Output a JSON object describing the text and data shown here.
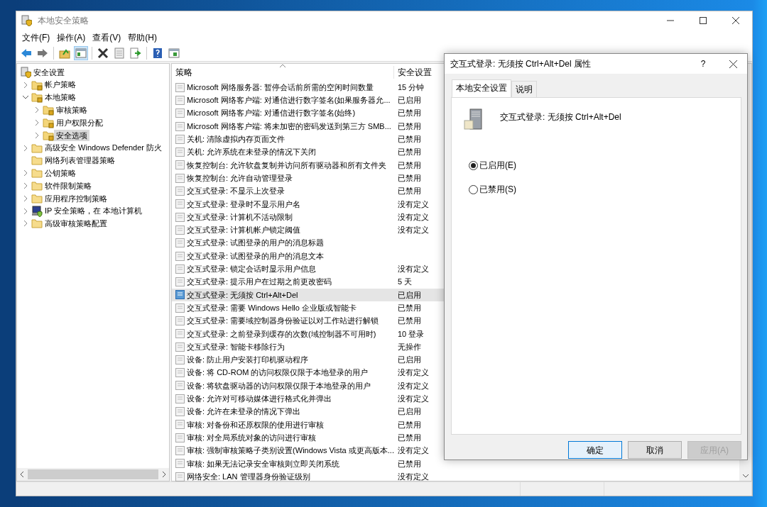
{
  "window": {
    "title": "本地安全策略"
  },
  "menu": [
    "文件(F)",
    "操作(A)",
    "查看(V)",
    "帮助(H)"
  ],
  "toolbar": [
    {
      "kind": "back"
    },
    {
      "kind": "forward"
    },
    {
      "kind": "sep"
    },
    {
      "kind": "up"
    },
    {
      "kind": "tree",
      "selected": true
    },
    {
      "kind": "sep"
    },
    {
      "kind": "delete"
    },
    {
      "kind": "properties"
    },
    {
      "kind": "export"
    },
    {
      "kind": "sep"
    },
    {
      "kind": "help"
    },
    {
      "kind": "view"
    }
  ],
  "tree": [
    {
      "label": "安全设置",
      "kind": "root",
      "selected": false,
      "children": [
        {
          "label": "帐户策略",
          "kind": "secure-folder",
          "expanded": false,
          "selected": false
        },
        {
          "label": "本地策略",
          "kind": "secure-folder",
          "expanded": true,
          "selected": false,
          "children": [
            {
              "label": "审核策略",
              "kind": "secure-folder",
              "expanded": false,
              "selected": false
            },
            {
              "label": "用户权限分配",
              "kind": "secure-folder",
              "expanded": false,
              "selected": false
            },
            {
              "label": "安全选项",
              "kind": "secure-folder",
              "expanded": false,
              "selected": true
            }
          ]
        },
        {
          "label": "高级安全 Windows Defender 防火",
          "kind": "folder",
          "expanded": false,
          "selected": false
        },
        {
          "label": "网络列表管理器策略",
          "kind": "folder",
          "selected": false
        },
        {
          "label": "公钥策略",
          "kind": "folder",
          "expanded": false,
          "selected": false
        },
        {
          "label": "软件限制策略",
          "kind": "folder",
          "expanded": false,
          "selected": false
        },
        {
          "label": "应用程序控制策略",
          "kind": "folder",
          "expanded": false,
          "selected": false
        },
        {
          "label": "IP 安全策略，在 本地计算机",
          "kind": "ip-security",
          "expanded": false,
          "selected": false
        },
        {
          "label": "高级审核策略配置",
          "kind": "folder",
          "expanded": false,
          "selected": false
        }
      ]
    }
  ],
  "table": {
    "columns": [
      "策略",
      "安全设置"
    ],
    "rows": [
      {
        "policy": "Microsoft 网络服务器: 暂停会话前所需的空闲时间数量",
        "setting": "15 分钟",
        "selected": false
      },
      {
        "policy": "Microsoft 网络客户端: 对通信进行数字签名(如果服务器允...",
        "setting": "已启用",
        "selected": false
      },
      {
        "policy": "Microsoft 网络客户端: 对通信进行数字签名(始终)",
        "setting": "已禁用",
        "selected": false
      },
      {
        "policy": "Microsoft 网络客户端: 将未加密的密码发送到第三方 SMB...",
        "setting": "已禁用",
        "selected": false
      },
      {
        "policy": "关机: 清除虚拟内存页面文件",
        "setting": "已禁用",
        "selected": false
      },
      {
        "policy": "关机: 允许系统在未登录的情况下关闭",
        "setting": "已禁用",
        "selected": false
      },
      {
        "policy": "恢复控制台: 允许软盘复制并访问所有驱动器和所有文件夹",
        "setting": "已禁用",
        "selected": false
      },
      {
        "policy": "恢复控制台: 允许自动管理登录",
        "setting": "已禁用",
        "selected": false
      },
      {
        "policy": "交互式登录: 不显示上次登录",
        "setting": "已禁用",
        "selected": false
      },
      {
        "policy": "交互式登录: 登录时不显示用户名",
        "setting": "没有定义",
        "selected": false
      },
      {
        "policy": "交互式登录: 计算机不活动限制",
        "setting": "没有定义",
        "selected": false
      },
      {
        "policy": "交互式登录: 计算机帐户锁定阈值",
        "setting": "没有定义",
        "selected": false
      },
      {
        "policy": "交互式登录: 试图登录的用户的消息标题",
        "selected": false
      },
      {
        "policy": "交互式登录: 试图登录的用户的消息文本",
        "selected": false
      },
      {
        "policy": "交互式登录: 锁定会话时显示用户信息",
        "setting": "没有定义",
        "selected": false
      },
      {
        "policy": "交互式登录: 提示用户在过期之前更改密码",
        "setting": "5 天",
        "selected": false
      },
      {
        "policy": "交互式登录: 无须按 Ctrl+Alt+Del",
        "setting": "已启用",
        "selected": true
      },
      {
        "policy": "交互式登录: 需要 Windows Hello 企业版或智能卡",
        "setting": "已禁用",
        "selected": false
      },
      {
        "policy": "交互式登录: 需要域控制器身份验证以对工作站进行解锁",
        "setting": "已禁用",
        "selected": false
      },
      {
        "policy": "交互式登录: 之前登录到缓存的次数(域控制器不可用时)",
        "setting": "10 登录",
        "selected": false
      },
      {
        "policy": "交互式登录: 智能卡移除行为",
        "setting": "无操作",
        "selected": false
      },
      {
        "policy": "设备: 防止用户安装打印机驱动程序",
        "setting": "已启用",
        "selected": false
      },
      {
        "policy": "设备: 将 CD-ROM 的访问权限仅限于本地登录的用户",
        "setting": "没有定义",
        "selected": false
      },
      {
        "policy": "设备: 将软盘驱动器的访问权限仅限于本地登录的用户",
        "setting": "没有定义",
        "selected": false
      },
      {
        "policy": "设备: 允许对可移动媒体进行格式化并弹出",
        "setting": "没有定义",
        "selected": false
      },
      {
        "policy": "设备: 允许在未登录的情况下弹出",
        "setting": "已启用",
        "selected": false
      },
      {
        "policy": "审核: 对备份和还原权限的使用进行审核",
        "setting": "已禁用",
        "selected": false
      },
      {
        "policy": "审核: 对全局系统对象的访问进行审核",
        "setting": "已禁用",
        "selected": false
      },
      {
        "policy": "审核: 强制审核策略子类别设置(Windows Vista 或更高版本...",
        "setting": "没有定义",
        "selected": false
      },
      {
        "policy": "审核: 如果无法记录安全审核则立即关闭系统",
        "setting": "已禁用",
        "selected": false
      },
      {
        "policy": "网络安全: LAN 管理器身份验证级别",
        "setting": "没有定义",
        "selected": false
      }
    ]
  },
  "dialog": {
    "title": "交互式登录: 无须按 Ctrl+Alt+Del 属性",
    "help": "?",
    "tabs": [
      {
        "label": "本地安全设置",
        "selected": true
      },
      {
        "label": "说明",
        "selected": false
      }
    ],
    "policy_name": "交互式登录: 无须按 Ctrl+Alt+Del",
    "options": [
      {
        "label": "已启用(E)",
        "selected": true
      },
      {
        "label": "已禁用(S)",
        "selected": false
      }
    ],
    "buttons": [
      {
        "label": "确定",
        "kind": "default",
        "disabled": false
      },
      {
        "label": "取消",
        "kind": "normal",
        "disabled": false
      },
      {
        "label": "应用(A)",
        "kind": "normal",
        "disabled": true
      }
    ]
  }
}
